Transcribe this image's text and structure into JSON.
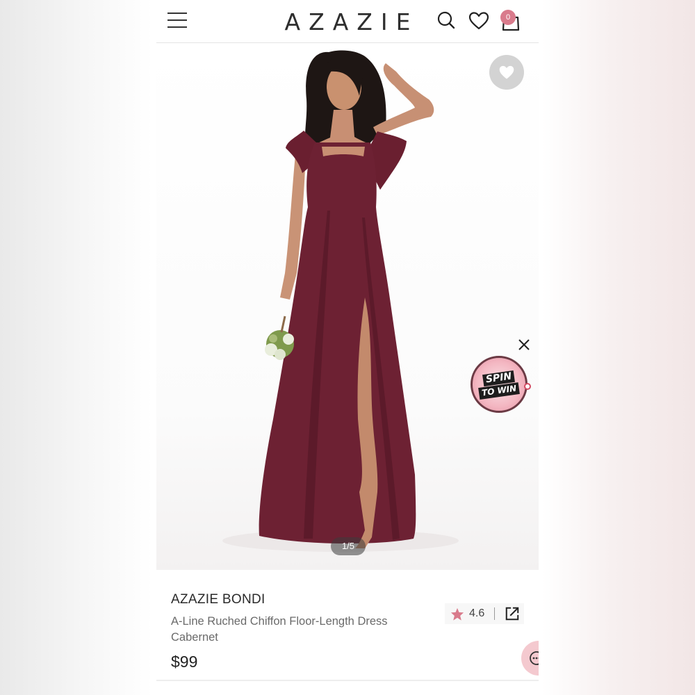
{
  "header": {
    "brand": "AZAZIE",
    "cart_count": "0",
    "icons": [
      "menu-icon",
      "search-icon",
      "heart-icon",
      "bag-icon"
    ]
  },
  "gallery": {
    "counter": "1/5",
    "favorite_icon": "heart-icon",
    "spin_widget": {
      "line1": "SPIN",
      "line2": "TO WIN"
    }
  },
  "product": {
    "brand_name": "AZAZIE BONDI",
    "title": "A-Line Ruched Chiffon Floor-Length Dress Cabernet",
    "price": "$99",
    "rating": "4.6"
  },
  "colors": {
    "accent": "#d97b8c",
    "dress": "#6d2133",
    "text_dark": "#2a2a2a",
    "text_muted": "#6a6a6a"
  }
}
